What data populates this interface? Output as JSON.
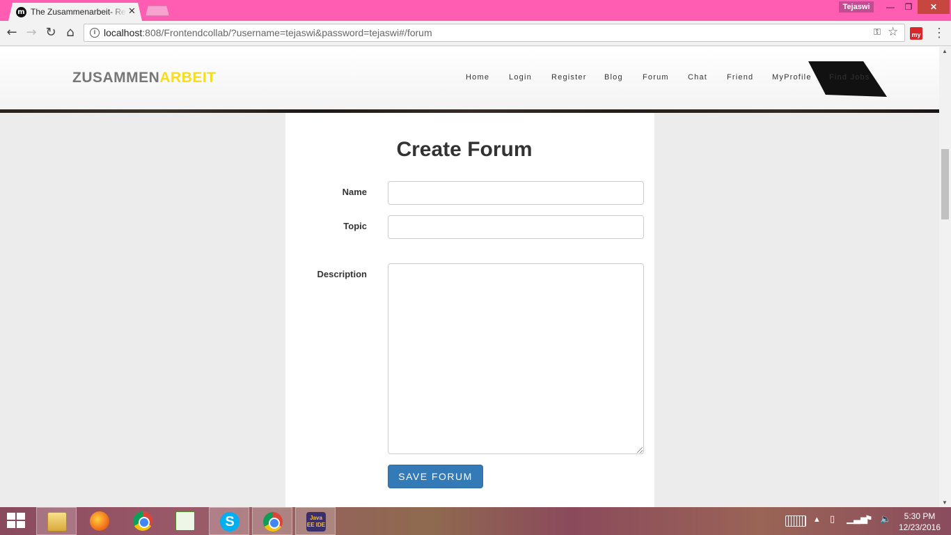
{
  "browser": {
    "tab_title": "The Zusammenarbeit- Re",
    "tab_favicon": "m",
    "tab_close": "✕",
    "user_name": "Tejaswi",
    "window_controls": {
      "minimize": "—",
      "maximize": "❐",
      "close": "✕"
    },
    "url_host": "localhost",
    "url_rest": ":808/Frontendcollab/?username=tejaswi&password=tejaswi#/forum",
    "extension_label": "my"
  },
  "site": {
    "brand_part1": "ZUSAMMEN",
    "brand_part2": "ARBEIT",
    "brand_colors": {
      "part1": "#777777",
      "part2": "#f6dd1e"
    },
    "nav": [
      "Home",
      "Login",
      "Register",
      "Blog",
      "Forum",
      "Chat",
      "Friend",
      "MyProfile",
      "Find Jobs"
    ]
  },
  "form": {
    "title": "Create Forum",
    "name_label": "Name",
    "name_value": "",
    "topic_label": "Topic",
    "topic_value": "",
    "description_label": "Description",
    "description_value": "",
    "submit_label": "SAVE FORUM",
    "submit_color": "#337ab7"
  },
  "taskbar": {
    "apps": [
      "file-explorer-icon",
      "firefox-icon",
      "chrome-icon",
      "notepad-plus-plus-icon",
      "skype-icon",
      "chrome-icon",
      "java-ee-ide-icon"
    ],
    "java_label": "Java EE IDE",
    "time": "5:30 PM",
    "date": "12/23/2016"
  }
}
